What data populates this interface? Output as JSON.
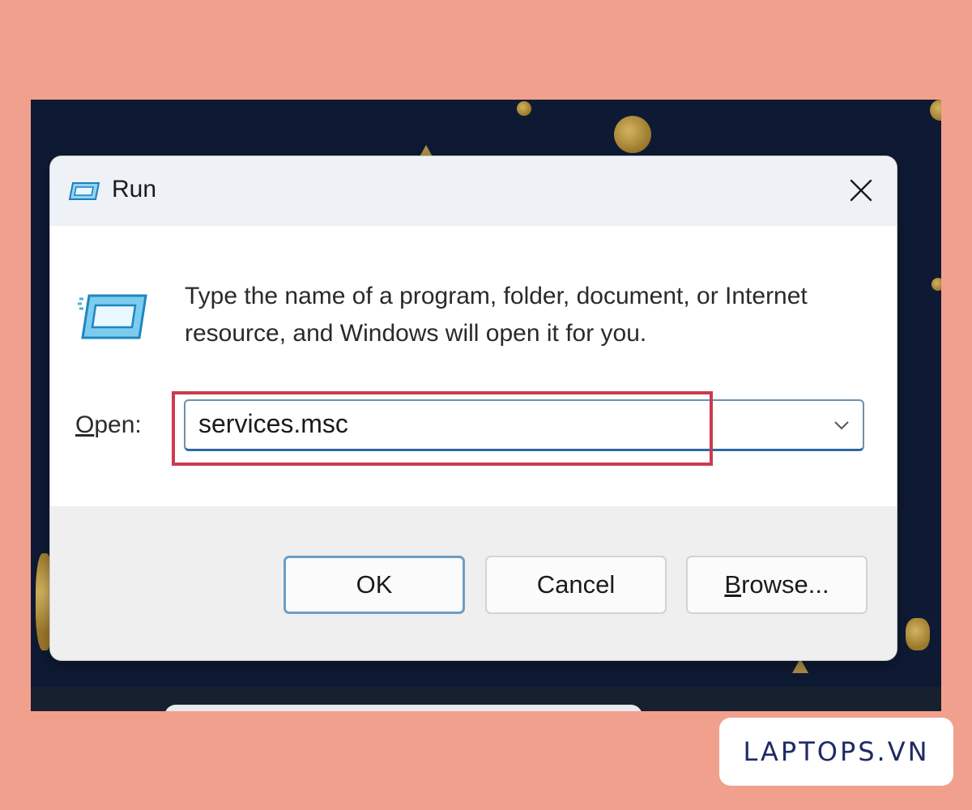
{
  "dialog": {
    "title": "Run",
    "description": "Type the name of a program, folder, document, or Internet resource, and Windows will open it for you.",
    "open_label_mnemonic": "O",
    "open_label_rest": "pen:",
    "open_value": "services.msc",
    "buttons": {
      "ok": "OK",
      "cancel": "Cancel",
      "browse_mnemonic": "B",
      "browse_rest": "rowse..."
    },
    "icons": {
      "title": "run-icon",
      "close": "close-icon",
      "dropdown": "chevron-down-icon"
    }
  },
  "watermark": {
    "text": "LAPTOPS.VN"
  },
  "colors": {
    "page_background": "#f2a08e",
    "highlight": "#c93c4e",
    "accent": "#2d6a9f",
    "brand_text": "#1f2a66"
  }
}
